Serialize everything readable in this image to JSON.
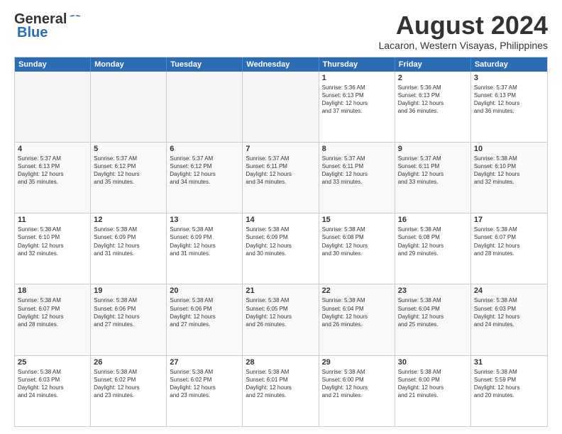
{
  "logo": {
    "line1": "General",
    "line2": "Blue"
  },
  "title": "August 2024",
  "location": "Lacaron, Western Visayas, Philippines",
  "days": [
    "Sunday",
    "Monday",
    "Tuesday",
    "Wednesday",
    "Thursday",
    "Friday",
    "Saturday"
  ],
  "weeks": [
    [
      {
        "day": "",
        "content": ""
      },
      {
        "day": "",
        "content": ""
      },
      {
        "day": "",
        "content": ""
      },
      {
        "day": "",
        "content": ""
      },
      {
        "day": "1",
        "content": "Sunrise: 5:36 AM\nSunset: 6:13 PM\nDaylight: 12 hours\nand 37 minutes."
      },
      {
        "day": "2",
        "content": "Sunrise: 5:36 AM\nSunset: 6:13 PM\nDaylight: 12 hours\nand 36 minutes."
      },
      {
        "day": "3",
        "content": "Sunrise: 5:37 AM\nSunset: 6:13 PM\nDaylight: 12 hours\nand 36 minutes."
      }
    ],
    [
      {
        "day": "4",
        "content": "Sunrise: 5:37 AM\nSunset: 6:13 PM\nDaylight: 12 hours\nand 35 minutes."
      },
      {
        "day": "5",
        "content": "Sunrise: 5:37 AM\nSunset: 6:12 PM\nDaylight: 12 hours\nand 35 minutes."
      },
      {
        "day": "6",
        "content": "Sunrise: 5:37 AM\nSunset: 6:12 PM\nDaylight: 12 hours\nand 34 minutes."
      },
      {
        "day": "7",
        "content": "Sunrise: 5:37 AM\nSunset: 6:11 PM\nDaylight: 12 hours\nand 34 minutes."
      },
      {
        "day": "8",
        "content": "Sunrise: 5:37 AM\nSunset: 6:11 PM\nDaylight: 12 hours\nand 33 minutes."
      },
      {
        "day": "9",
        "content": "Sunrise: 5:37 AM\nSunset: 6:11 PM\nDaylight: 12 hours\nand 33 minutes."
      },
      {
        "day": "10",
        "content": "Sunrise: 5:38 AM\nSunset: 6:10 PM\nDaylight: 12 hours\nand 32 minutes."
      }
    ],
    [
      {
        "day": "11",
        "content": "Sunrise: 5:38 AM\nSunset: 6:10 PM\nDaylight: 12 hours\nand 32 minutes."
      },
      {
        "day": "12",
        "content": "Sunrise: 5:38 AM\nSunset: 6:09 PM\nDaylight: 12 hours\nand 31 minutes."
      },
      {
        "day": "13",
        "content": "Sunrise: 5:38 AM\nSunset: 6:09 PM\nDaylight: 12 hours\nand 31 minutes."
      },
      {
        "day": "14",
        "content": "Sunrise: 5:38 AM\nSunset: 6:09 PM\nDaylight: 12 hours\nand 30 minutes."
      },
      {
        "day": "15",
        "content": "Sunrise: 5:38 AM\nSunset: 6:08 PM\nDaylight: 12 hours\nand 30 minutes."
      },
      {
        "day": "16",
        "content": "Sunrise: 5:38 AM\nSunset: 6:08 PM\nDaylight: 12 hours\nand 29 minutes."
      },
      {
        "day": "17",
        "content": "Sunrise: 5:38 AM\nSunset: 6:07 PM\nDaylight: 12 hours\nand 28 minutes."
      }
    ],
    [
      {
        "day": "18",
        "content": "Sunrise: 5:38 AM\nSunset: 6:07 PM\nDaylight: 12 hours\nand 28 minutes."
      },
      {
        "day": "19",
        "content": "Sunrise: 5:38 AM\nSunset: 6:06 PM\nDaylight: 12 hours\nand 27 minutes."
      },
      {
        "day": "20",
        "content": "Sunrise: 5:38 AM\nSunset: 6:06 PM\nDaylight: 12 hours\nand 27 minutes."
      },
      {
        "day": "21",
        "content": "Sunrise: 5:38 AM\nSunset: 6:05 PM\nDaylight: 12 hours\nand 26 minutes."
      },
      {
        "day": "22",
        "content": "Sunrise: 5:38 AM\nSunset: 6:04 PM\nDaylight: 12 hours\nand 26 minutes."
      },
      {
        "day": "23",
        "content": "Sunrise: 5:38 AM\nSunset: 6:04 PM\nDaylight: 12 hours\nand 25 minutes."
      },
      {
        "day": "24",
        "content": "Sunrise: 5:38 AM\nSunset: 6:03 PM\nDaylight: 12 hours\nand 24 minutes."
      }
    ],
    [
      {
        "day": "25",
        "content": "Sunrise: 5:38 AM\nSunset: 6:03 PM\nDaylight: 12 hours\nand 24 minutes."
      },
      {
        "day": "26",
        "content": "Sunrise: 5:38 AM\nSunset: 6:02 PM\nDaylight: 12 hours\nand 23 minutes."
      },
      {
        "day": "27",
        "content": "Sunrise: 5:38 AM\nSunset: 6:02 PM\nDaylight: 12 hours\nand 23 minutes."
      },
      {
        "day": "28",
        "content": "Sunrise: 5:38 AM\nSunset: 6:01 PM\nDaylight: 12 hours\nand 22 minutes."
      },
      {
        "day": "29",
        "content": "Sunrise: 5:38 AM\nSunset: 6:00 PM\nDaylight: 12 hours\nand 21 minutes."
      },
      {
        "day": "30",
        "content": "Sunrise: 5:38 AM\nSunset: 6:00 PM\nDaylight: 12 hours\nand 21 minutes."
      },
      {
        "day": "31",
        "content": "Sunrise: 5:38 AM\nSunset: 5:59 PM\nDaylight: 12 hours\nand 20 minutes."
      }
    ]
  ]
}
